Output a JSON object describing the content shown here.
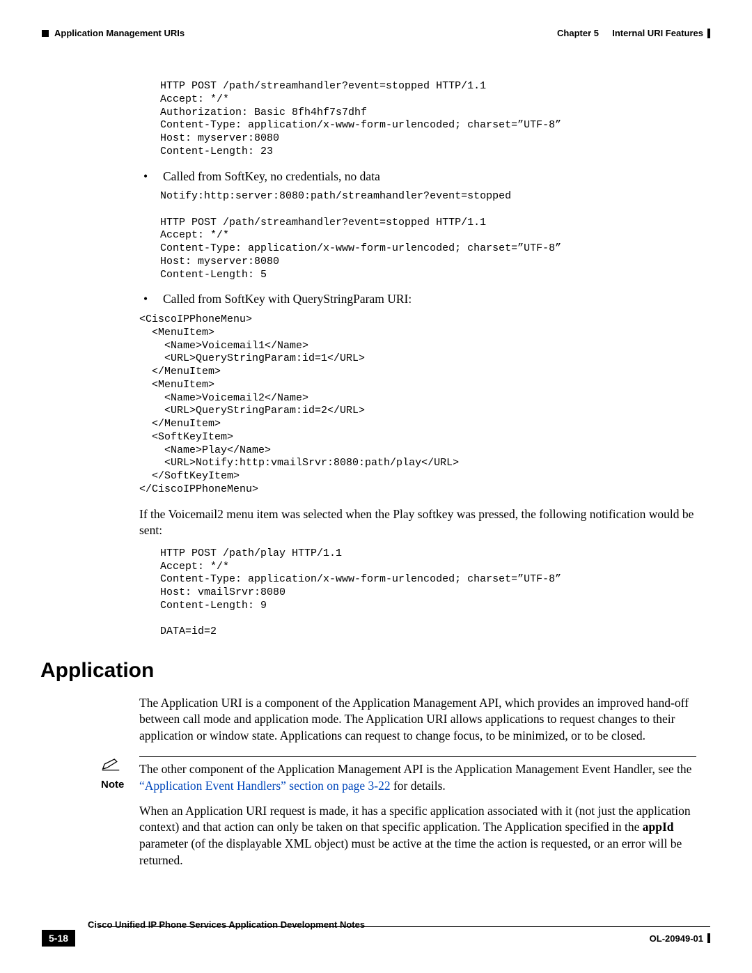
{
  "header": {
    "left": "Application Management URIs",
    "chapter": "Chapter 5",
    "right_title": "Internal URI Features"
  },
  "code1": "HTTP POST /path/streamhandler?event=stopped HTTP/1.1\nAccept: */*\nAuthorization: Basic 8fh4hf7s7dhf\nContent-Type: application/x-www-form-urlencoded; charset=”UTF-8”\nHost: myserver:8080\nContent-Length: 23",
  "bullet1": "Called from SoftKey, no credentials, no data",
  "code2": "Notify:http:server:8080:path/streamhandler?event=stopped\n\nHTTP POST /path/streamhandler?event=stopped HTTP/1.1\nAccept: */*\nContent-Type: application/x-www-form-urlencoded; charset=”UTF-8”\nHost: myserver:8080\nContent-Length: 5",
  "bullet2": "Called from SoftKey with QueryStringParam URI:",
  "code3": "<CiscoIPPhoneMenu>\n  <MenuItem>\n    <Name>Voicemail1</Name>\n    <URL>QueryStringParam:id=1</URL>\n  </MenuItem>\n  <MenuItem>\n    <Name>Voicemail2</Name>\n    <URL>QueryStringParam:id=2</URL>\n  </MenuItem>\n  <SoftKeyItem>\n    <Name>Play</Name>\n    <URL>Notify:http:vmailSrvr:8080:path/play</URL>\n  </SoftKeyItem>\n</CiscoIPPhoneMenu>",
  "para1": "If the Voicemail2 menu item was selected when the Play softkey was pressed, the following notification would be sent:",
  "code4": "HTTP POST /path/play HTTP/1.1\nAccept: */*\nContent-Type: application/x-www-form-urlencoded; charset=”UTF-8”\nHost: vmailSrvr:8080\nContent-Length: 9\n\nDATA=id=2",
  "section_title": "Application",
  "para2": "The Application URI is a component of the Application Management API, which provides an improved hand-off between call mode and application mode. The Application URI allows applications to request changes to their application or window state. Applications can request to change focus, to be minimized, or to be closed.",
  "note": {
    "label": "Note",
    "text_before_link": "The other component of the Application Management API is the Application Management Event Handler, see the ",
    "link": "“Application Event Handlers” section on page 3-22",
    "text_after_link": " for details."
  },
  "para3_a": "When an Application URI request is made, it has a specific application associated with it (not just the application context) and that action can only be taken on that specific application. The Application specified in the ",
  "para3_bold": "appId",
  "para3_b": " parameter (of the displayable XML object) must be active at the time the action is requested, or an error will be returned.",
  "footer": {
    "page": "5-18",
    "title": "Cisco Unified IP Phone Services Application Development Notes",
    "doc": "OL-20949-01"
  }
}
